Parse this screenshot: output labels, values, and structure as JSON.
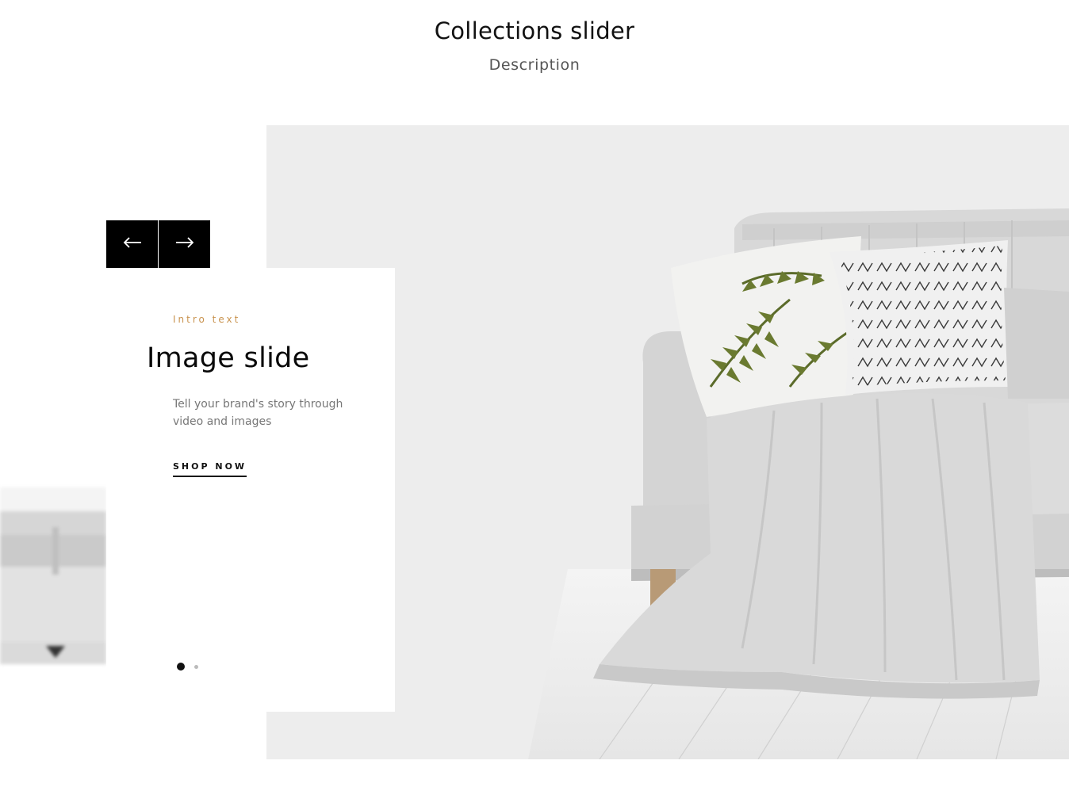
{
  "section": {
    "title": "Collections slider",
    "description": "Description"
  },
  "slide": {
    "intro": "Intro text",
    "heading": "Image slide",
    "text": "Tell your brand's story through video and images",
    "cta": "SHOP NOW"
  },
  "navigation": {
    "prev_icon": "arrow-left-icon",
    "next_icon": "arrow-right-icon",
    "dots_count": 2,
    "active_dot": 1
  },
  "colors": {
    "accent": "#c9934f",
    "button_bg": "#000000",
    "image_bg": "#ededed"
  }
}
